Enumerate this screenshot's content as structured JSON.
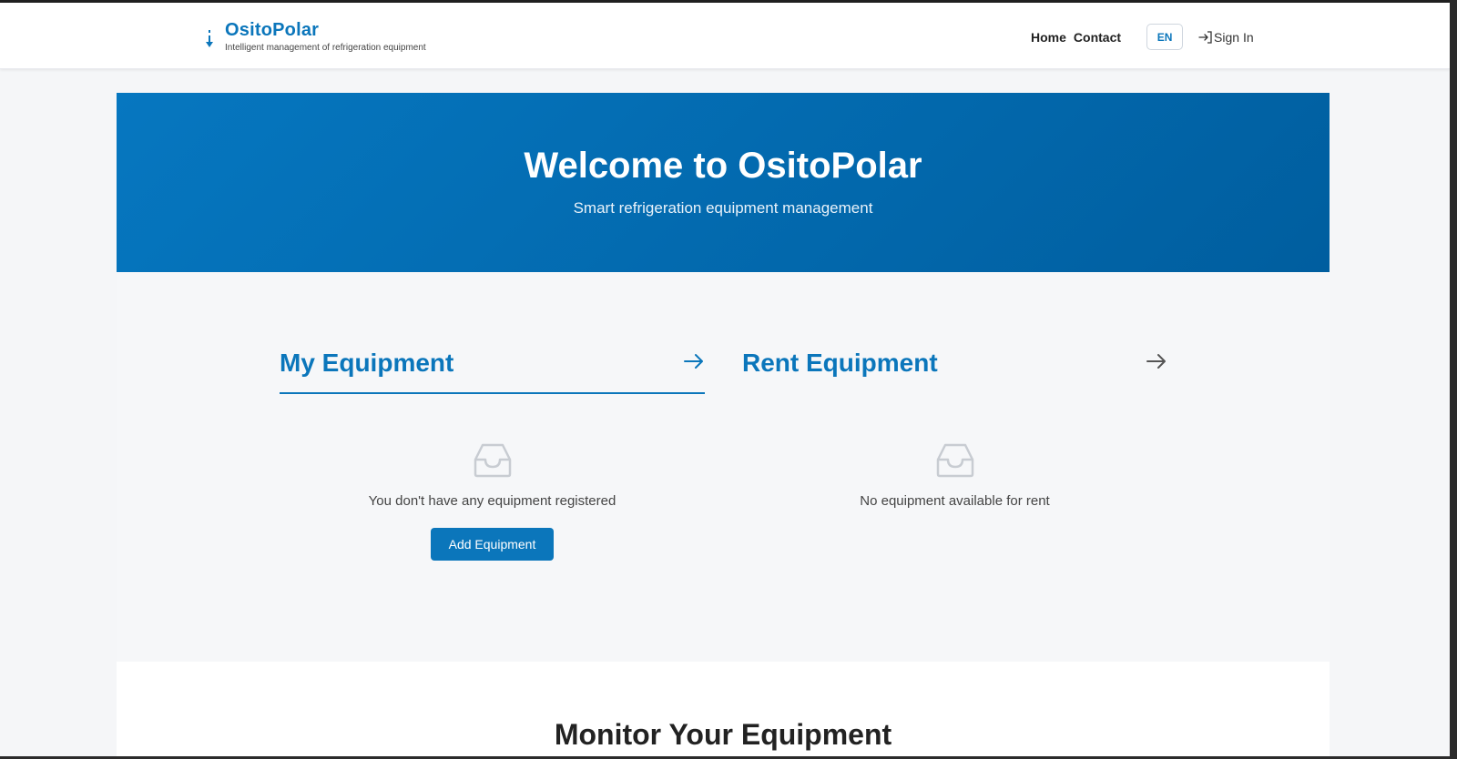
{
  "header": {
    "brand_name": "OsitoPolar",
    "brand_tagline": "Intelligent management of refrigeration equipment",
    "nav": [
      "Home",
      "Contact"
    ],
    "language": "EN",
    "signin_label": "Sign In"
  },
  "hero": {
    "title": "Welcome to OsitoPolar",
    "subtitle": "Smart refrigeration equipment management"
  },
  "panels": {
    "my_equipment": {
      "title": "My Equipment",
      "empty_text": "You don't have any equipment registered",
      "button_label": "Add Equipment"
    },
    "rent_equipment": {
      "title": "Rent Equipment",
      "empty_text": "No equipment available for rent"
    }
  },
  "monitor": {
    "title": "Monitor Your Equipment"
  },
  "colors": {
    "brand": "#0b76bb",
    "hero_start": "#0677c0",
    "hero_end": "#005e9f"
  }
}
